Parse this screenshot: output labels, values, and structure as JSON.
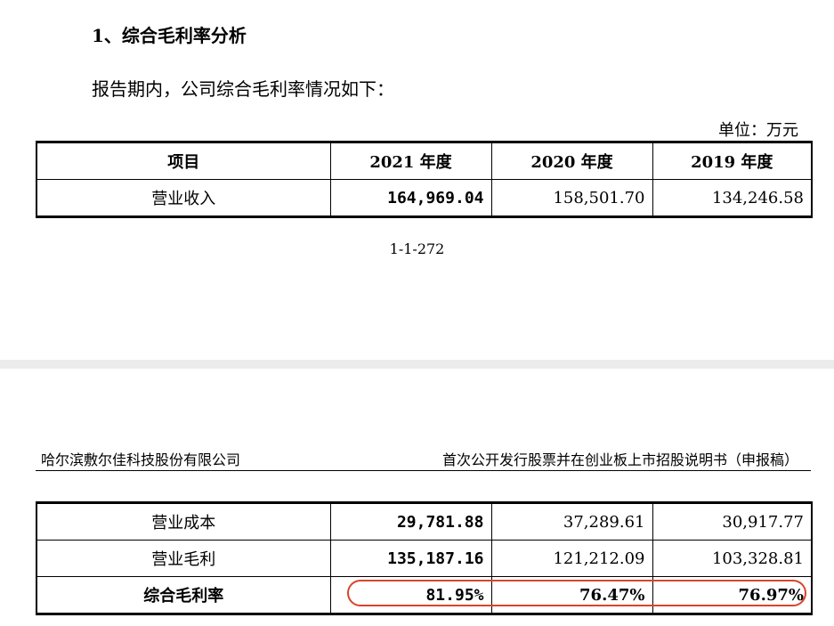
{
  "section": {
    "heading": "1、综合毛利率分析",
    "intro": "报告期内，公司综合毛利率情况如下：",
    "unit": "单位：万元"
  },
  "table": {
    "headers": [
      "项目",
      "2021 年度",
      "2020 年度",
      "2019 年度"
    ],
    "rows_page1": [
      [
        "营业收入",
        "164,969.04",
        "158,501.70",
        "134,246.58"
      ]
    ],
    "rows_page2": [
      [
        "营业成本",
        "29,781.88",
        "37,289.61",
        "30,917.77"
      ],
      [
        "营业毛利",
        "135,187.16",
        "121,212.09",
        "103,328.81"
      ],
      [
        "综合毛利率",
        "81.95%",
        "76.47%",
        "76.97%"
      ]
    ]
  },
  "page_number": "1-1-272",
  "page_header": {
    "company": "哈尔滨敷尔佳科技股份有限公司",
    "document": "首次公开发行股票并在创业板上市招股说明书（申报稿）"
  },
  "colors": {
    "highlight": "#d9442b",
    "divider": "#ececec"
  }
}
